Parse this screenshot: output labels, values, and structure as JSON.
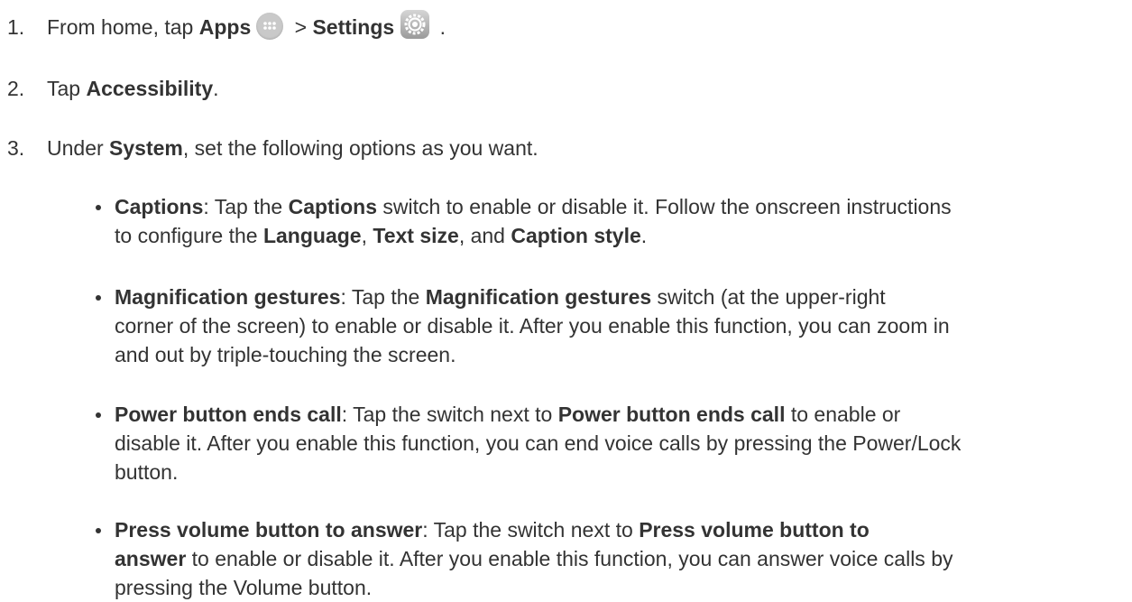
{
  "steps": [
    {
      "num": "1.",
      "pre": "From home, tap ",
      "b1": "Apps",
      "mid": " > ",
      "b2": "Settings",
      "post": " ."
    },
    {
      "num": "2.",
      "pre": "Tap ",
      "b1": "Accessibility",
      "post": "."
    },
    {
      "num": "3.",
      "pre": "Under ",
      "b1": "System",
      "post": ", set the following options as you want."
    }
  ],
  "bullets": [
    {
      "term": "Captions",
      "lines": [
        [
          {
            "t": ": Tap the "
          },
          {
            "b": "Captions"
          },
          {
            "t": " switch to enable or disable it. Follow the onscreen instructions"
          }
        ],
        [
          {
            "t": "to configure the "
          },
          {
            "b": "Language"
          },
          {
            "t": ", "
          },
          {
            "b": "Text size"
          },
          {
            "t": ", and "
          },
          {
            "b": "Caption style"
          },
          {
            "t": "."
          }
        ]
      ]
    },
    {
      "term": "Magnification gestures",
      "lines": [
        [
          {
            "t": ": Tap the "
          },
          {
            "b": "Magnification gestures"
          },
          {
            "t": " switch (at the upper-right"
          }
        ],
        [
          {
            "t": "corner of the screen) to enable or disable it. After you enable this function, you can zoom in"
          }
        ],
        [
          {
            "t": "and out by triple-touching the screen."
          }
        ]
      ]
    },
    {
      "term": "Power button ends call",
      "lines": [
        [
          {
            "t": ": Tap the switch next to "
          },
          {
            "b": "Power button ends call"
          },
          {
            "t": " to enable or"
          }
        ],
        [
          {
            "t": "disable it. After you enable this function, you can end voice calls by pressing the Power/Lock"
          }
        ],
        [
          {
            "t": "button."
          }
        ]
      ]
    },
    {
      "term": "Press volume button to answer",
      "lines": [
        [
          {
            "t": ": Tap the switch next to "
          },
          {
            "b": "Press volume button to"
          }
        ],
        [
          {
            "b": "answer"
          },
          {
            "t": " to enable or disable it. After you enable this function, you can answer voice calls by"
          }
        ],
        [
          {
            "t": "pressing the Volume button."
          }
        ]
      ]
    }
  ],
  "icons": {
    "apps": "apps-icon",
    "settings": "settings-icon"
  }
}
